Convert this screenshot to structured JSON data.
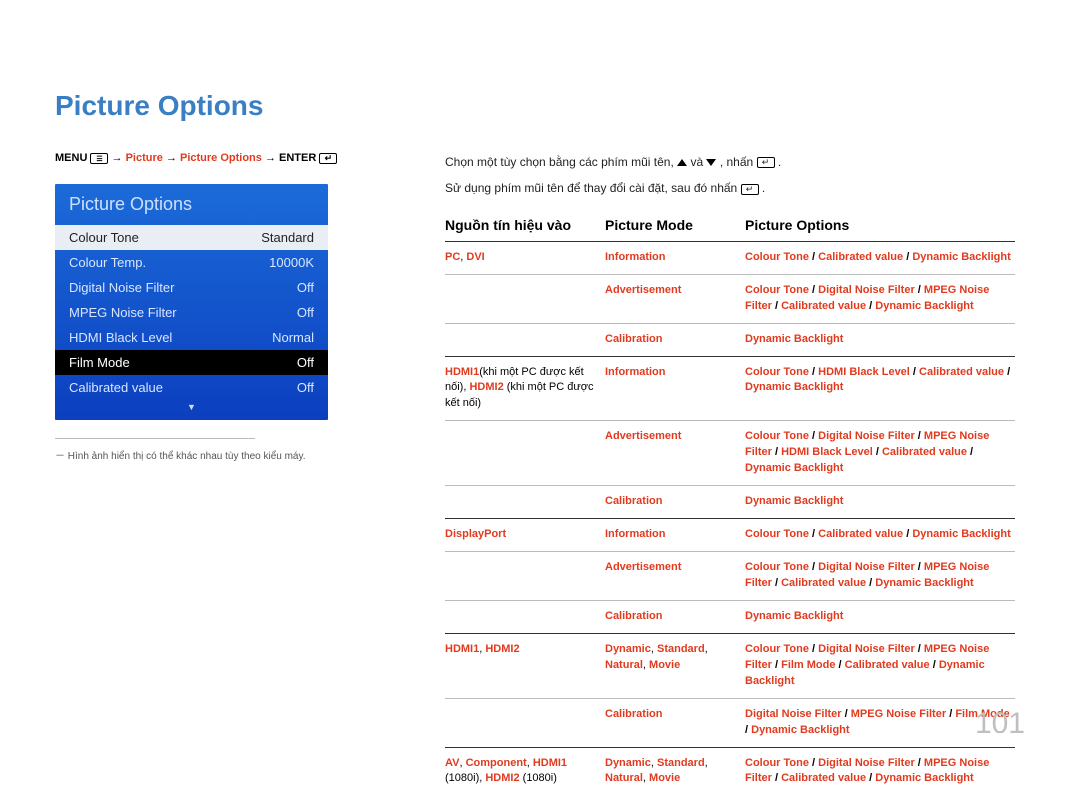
{
  "title": "Picture Options",
  "breadcrumb": {
    "menu": "MENU",
    "arrow": " → ",
    "p1": "Picture",
    "p2": "Picture Options",
    "enter": "ENTER"
  },
  "osd": {
    "header": "Picture Options",
    "items": [
      {
        "label": "Colour Tone",
        "value": "Standard",
        "style": "white"
      },
      {
        "label": "Colour Temp.",
        "value": "10000K",
        "style": ""
      },
      {
        "label": "Digital Noise Filter",
        "value": "Off",
        "style": ""
      },
      {
        "label": "MPEG Noise Filter",
        "value": "Off",
        "style": ""
      },
      {
        "label": "HDMI Black Level",
        "value": "Normal",
        "style": ""
      },
      {
        "label": "Film Mode",
        "value": "Off",
        "style": "dark"
      },
      {
        "label": "Calibrated value",
        "value": "Off",
        "style": ""
      }
    ]
  },
  "note": "－ Hình ảnh hiển thị có thể khác nhau tùy theo kiểu máy.",
  "instruction1_a": "Chọn một tùy chọn bằng các phím mũi tên, ",
  "instruction1_b": " và ",
  "instruction1_c": ", nhấn ",
  "instruction1_d": ".",
  "instruction2_a": "Sử dụng phím mũi tên để thay đổi cài đặt, sau đó nhấn ",
  "instruction2_b": ".",
  "table_headers": {
    "h1": "Nguồn tín hiệu vào",
    "h2": "Picture Mode",
    "h3": "Picture Options"
  },
  "table": [
    {
      "source_html": "<span class='hl'>PC</span><span class='plain'>, </span><span class='hl'>DVI</span>",
      "rows": [
        {
          "mode": "<span class='hl'>Information</span>",
          "opts": "<span class='hl'>Colour Tone</span> <span class='blk'>/</span> <span class='hl'>Calibrated value</span> <span class='blk'>/</span> <span class='hl'>Dynamic Backlight</span>"
        },
        {
          "mode": "<span class='hl'>Advertisement</span>",
          "opts": "<span class='hl'>Colour Tone</span> <span class='blk'>/</span> <span class='hl'>Digital Noise Filter</span> <span class='blk'>/</span> <span class='hl'>MPEG Noise Filter</span> <span class='blk'>/</span> <span class='hl'>Calibrated value</span> <span class='blk'>/</span> <span class='hl'>Dynamic Backlight</span>"
        },
        {
          "mode": "<span class='hl'>Calibration</span>",
          "opts": "<span class='hl'>Dynamic Backlight</span>"
        }
      ]
    },
    {
      "source_html": "<span class='hl'>HDMI1</span><span class='plain'>(khi một PC được kết nối), </span><span class='hl'>HDMI2</span><span class='plain'> (khi một PC được kết nối)</span>",
      "rows": [
        {
          "mode": "<span class='hl'>Information</span>",
          "opts": "<span class='hl'>Colour Tone</span> <span class='blk'>/</span> <span class='hl'>HDMI Black Level</span> <span class='blk'>/</span> <span class='hl'>Calibrated value</span> <span class='blk'>/</span> <span class='hl'>Dynamic Backlight</span>"
        },
        {
          "mode": "<span class='hl'>Advertisement</span>",
          "opts": "<span class='hl'>Colour Tone</span> <span class='blk'>/</span> <span class='hl'>Digital Noise Filter</span> <span class='blk'>/</span> <span class='hl'>MPEG Noise Filter</span> <span class='blk'>/</span> <span class='hl'>HDMI Black Level</span> <span class='blk'>/</span> <span class='hl'>Calibrated value</span> <span class='blk'>/</span> <span class='hl'>Dynamic Backlight</span>"
        },
        {
          "mode": "<span class='hl'>Calibration</span>",
          "opts": "<span class='hl'>Dynamic Backlight</span>"
        }
      ]
    },
    {
      "source_html": "<span class='hl'>DisplayPort</span>",
      "rows": [
        {
          "mode": "<span class='hl'>Information</span>",
          "opts": "<span class='hl'>Colour Tone</span> <span class='blk'>/</span> <span class='hl'>Calibrated value</span> <span class='blk'>/</span> <span class='hl'>Dynamic Backlight</span>"
        },
        {
          "mode": "<span class='hl'>Advertisement</span>",
          "opts": "<span class='hl'>Colour Tone</span> <span class='blk'>/</span> <span class='hl'>Digital Noise Filter</span> <span class='blk'>/</span> <span class='hl'>MPEG Noise Filter</span> <span class='blk'>/</span> <span class='hl'>Calibrated value</span> <span class='blk'>/</span> <span class='hl'>Dynamic Backlight</span>"
        },
        {
          "mode": "<span class='hl'>Calibration</span>",
          "opts": "<span class='hl'>Dynamic Backlight</span>"
        }
      ]
    },
    {
      "source_html": "<span class='hl'>HDMI1</span><span class='plain'>, </span><span class='hl'>HDMI2</span>",
      "rows": [
        {
          "mode": "<span class='hl'>Dynamic</span><span class='plain'>, </span><span class='hl'>Standard</span><span class='plain'>, </span><span class='hl'>Natural</span><span class='plain'>, </span><span class='hl'>Movie</span>",
          "opts": "<span class='hl'>Colour Tone</span> <span class='blk'>/</span> <span class='hl'>Digital Noise Filter</span> <span class='blk'>/</span> <span class='hl'>MPEG Noise Filter</span> <span class='blk'>/</span> <span class='hl'>Film Mode</span> <span class='blk'>/</span> <span class='hl'>Calibrated value</span> <span class='blk'>/</span> <span class='hl'>Dynamic Backlight</span>"
        },
        {
          "mode": "<span class='hl'>Calibration</span>",
          "opts": "<span class='hl'>Digital Noise Filter</span> <span class='blk'>/</span> <span class='hl'>MPEG Noise Filter</span> <span class='blk'>/</span> <span class='hl'>Film Mode</span> <span class='blk'>/</span> <span class='hl'>Dynamic Backlight</span>"
        }
      ]
    },
    {
      "source_html": "<span class='hl'>AV</span><span class='plain'>, </span><span class='hl'>Component</span><span class='plain'>, </span><span class='hl'>HDMI1</span><span class='plain'> (1080i), </span><span class='hl'>HDMI2</span><span class='plain'> (1080i)</span>",
      "rows": [
        {
          "mode": "<span class='hl'>Dynamic</span><span class='plain'>, </span><span class='hl'>Standard</span><span class='plain'>, </span><span class='hl'>Natural</span><span class='plain'>, </span><span class='hl'>Movie</span>",
          "opts": "<span class='hl'>Colour Tone</span> <span class='blk'>/</span> <span class='hl'>Digital Noise Filter</span> <span class='blk'>/</span> <span class='hl'>MPEG Noise Filter</span> <span class='blk'>/</span> <span class='hl'>Calibrated value</span> <span class='blk'>/</span> <span class='hl'>Dynamic Backlight</span>"
        }
      ]
    }
  ],
  "page_number": "101"
}
